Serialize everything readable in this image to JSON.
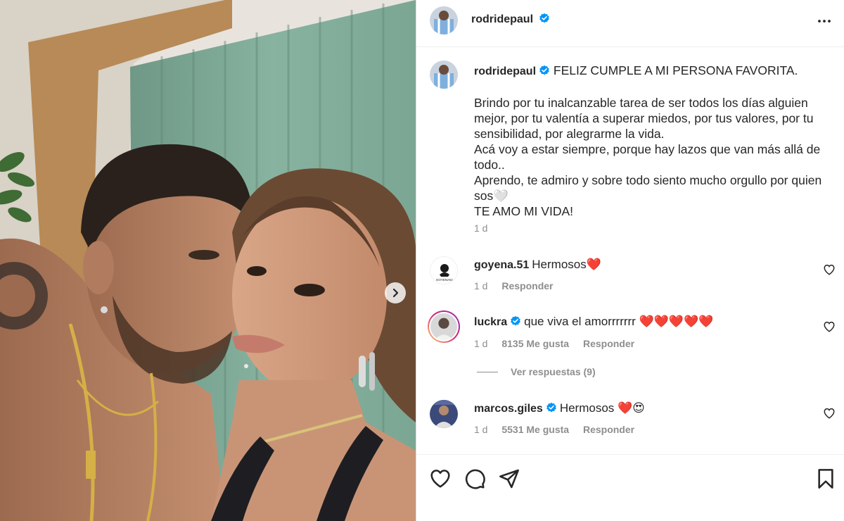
{
  "post": {
    "username": "rodridepaul",
    "carousel_next_icon": "chevron-right-icon"
  },
  "caption": {
    "username": "rodridepaul",
    "first_line": "FELIZ CUMPLE A MI PERSONA FAVORITA.",
    "lines": [
      "Brindo por tu inalcanzable tarea de ser todos los días alguien",
      "mejor, por tu valentía a superar miedos, por tus valores, por tu",
      "sensibilidad, por alegrarme la vida.",
      "Acá voy a estar siempre, porque hay lazos que van más allá de",
      "todo..",
      "Aprendo, te admiro y sobre todo siento mucho orgullo por quien",
      "sos🤍",
      "TE AMO MI VIDA!"
    ],
    "time": "1 d"
  },
  "comments": [
    {
      "username": "goyena.51",
      "verified": false,
      "text": "Hermosos❤️",
      "time": "1 d",
      "likes": "",
      "reply_label": "Responder"
    },
    {
      "username": "luckra",
      "verified": true,
      "text": "que viva el amorrrrrrr ❤️❤️❤️❤️❤️",
      "time": "1 d",
      "likes": "8135 Me gusta",
      "reply_label": "Responder"
    },
    {
      "username": "marcos.giles",
      "verified": true,
      "text": "Hermosos ❤️😍",
      "time": "1 d",
      "likes": "5531 Me gusta",
      "reply_label": "Responder"
    }
  ],
  "view_replies": "Ver respuestas (9)",
  "avatar_logo_text": "GOYENA51",
  "colors": {
    "verified": "#0095f6",
    "text": "#262626",
    "muted": "#8e8e8e",
    "story_ring": "#d62976"
  }
}
